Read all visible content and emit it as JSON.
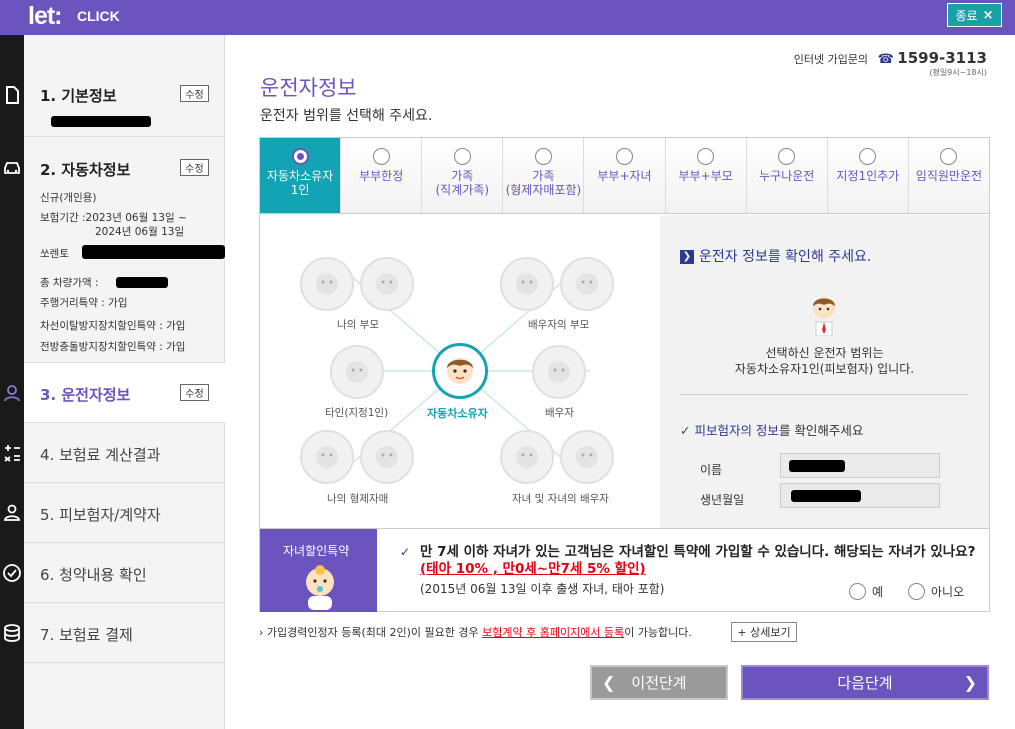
{
  "header": {
    "logo": "let:",
    "logo_sub": "CLICK",
    "close_label": "종료",
    "close_icon": "×"
  },
  "sidebar": {
    "steps": [
      {
        "title": "1. 기본정보",
        "edit": "수정"
      },
      {
        "title": "2. 자동차정보",
        "edit": "수정"
      },
      {
        "title": "3. 운전자정보",
        "edit": "수정"
      },
      {
        "title": "4. 보험료 계산결과"
      },
      {
        "title": "5. 피보험자/계약자"
      },
      {
        "title": "6. 청약내용 확인"
      },
      {
        "title": "7. 보험료 결제"
      }
    ],
    "car_details": [
      "신규(개인용)",
      "보험기간 :2023년 06월 13일 ~",
      "2024년 06월 13일",
      "쏘렌토",
      "총 차량가액 : ",
      "주행거리특약 : 가입",
      "차선이탈방지장치할인특약 : 가입",
      "전방충돌방지장치할인특약 : 가입"
    ]
  },
  "contact": {
    "label": "인터넷 가입문의",
    "phone": "1599-3113",
    "hours": "(평일9시~18시)"
  },
  "main": {
    "title": "운전자정보",
    "subtitle": "운전자 범위를 선택해 주세요."
  },
  "tabs": [
    {
      "label": "자동차소유자\n1인",
      "selected": true
    },
    {
      "label": "부부한정"
    },
    {
      "label": "가족\n(직계가족)"
    },
    {
      "label": "가족\n(형제자매포함)"
    },
    {
      "label": "부부+자녀"
    },
    {
      "label": "부부+부모"
    },
    {
      "label": "누구나운전"
    },
    {
      "label": "지정1인추가"
    },
    {
      "label": "임직원만운전"
    }
  ],
  "diagram": {
    "center": "자동차소유자",
    "my_parents": "나의 부모",
    "spouse_parents": "배우자의 부모",
    "other": "타인(지정1인)",
    "spouse": "배우자",
    "siblings": "나의 형제자매",
    "children": "자녀 및 자녀의 배우자"
  },
  "info": {
    "title": "운전자 정보를 확인해 주세요.",
    "text1": "선택하신 운전자 범위는",
    "text2": "자동차소유자1인(피보험자) 입니다.",
    "check_blue": "피보험자의 정보",
    "check_rest": "를 확인해주세요",
    "name_label": "이름",
    "birth_label": "생년월일"
  },
  "discount": {
    "label": "자녀할인특약",
    "question": "만 7세 이하 자녀가 있는 고객님은 자녀할인 특약에 가입할 수 있습니다. 해당되는 자녀가 있나요? ",
    "highlight": "(태아 10% , 만0세~만7세 5% 할인)",
    "note": "(2015년 06월 13일 이후 출생 자녀, 태아 포함)",
    "yes": "예",
    "no": "아니오"
  },
  "footnote": {
    "prefix": "› 가입경력인정자 등록(최대 2인)이 필요한 경우 ",
    "link": "보험계약 후 홈페이지에서 등록",
    "suffix": "이 가능합니다.",
    "detail_btn": "+ 상세보기"
  },
  "buttons": {
    "prev": "이전단계",
    "next": "다음단계"
  },
  "colors": {
    "brand": "#6b54bd",
    "accent": "#12a3b5",
    "navy": "#2c3b8f",
    "warn": "#e60012"
  }
}
